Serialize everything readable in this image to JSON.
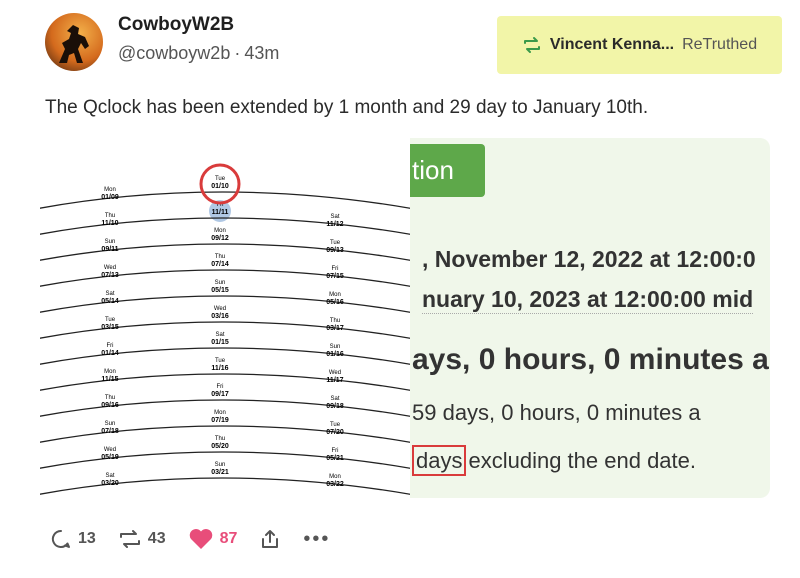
{
  "post": {
    "author_name": "CowboyW2B",
    "handle": "@cowboyw2b",
    "separator": "·",
    "time_ago": "43m",
    "retruth_by": "Vincent Kenna...",
    "retruth_label": "ReTruthed",
    "text": "The Qclock has been extended by 1 month and 29 day to January 10th."
  },
  "qclock_image": {
    "rows": [
      {
        "left": "Mon 01/09",
        "mid": "Tue 01/10",
        "right": ""
      },
      {
        "left": "Thu 11/10",
        "mid": "Fri 11/11",
        "right": "Sat 11/12"
      },
      {
        "left": "Sun 09/11",
        "mid": "Mon 09/12",
        "right": "Tue 09/13"
      },
      {
        "left": "Wed 07/13",
        "mid": "Thu 07/14",
        "right": "Fri 07/15"
      },
      {
        "left": "Sat 05/14",
        "mid": "Sun 05/15",
        "right": "Mon 05/16"
      },
      {
        "left": "Tue 03/15",
        "mid": "Wed 03/16",
        "right": "Thu 03/17"
      },
      {
        "left": "Fri 01/14",
        "mid": "Sat 01/15",
        "right": "Sun 01/16"
      },
      {
        "left": "Mon 11/15",
        "mid": "Tue 11/16",
        "right": "Wed 11/17"
      },
      {
        "left": "Thu 09/16",
        "mid": "Fri 09/17",
        "right": "Sat 09/18"
      },
      {
        "left": "Sun 07/18",
        "mid": "Mon 07/19",
        "right": "Tue 07/20"
      },
      {
        "left": "Wed 05/19",
        "mid": "Thu 05/20",
        "right": "Fri 05/21"
      },
      {
        "left": "Sat 03/20",
        "mid": "Sun 03/21",
        "right": "Mon 03/22"
      }
    ]
  },
  "calc_screenshot": {
    "button_partial": "tion",
    "line1": ", November 12, 2022 at 12:00:0",
    "line2": "nuary 10, 2023 at 12:00:00 mid",
    "line3": "ays, 0 hours, 0 minutes a",
    "line4": "59 days, 0 hours, 0 minutes a",
    "line5_boxed": "days",
    "line5_rest": "excluding the end date."
  },
  "actions": {
    "replies": "13",
    "retruths": "43",
    "likes": "87"
  },
  "colors": {
    "retruth_bg": "#f2f5a8",
    "like": "#e84d7a",
    "button_green": "#5ea84a",
    "circle_red": "#d93b3b"
  }
}
